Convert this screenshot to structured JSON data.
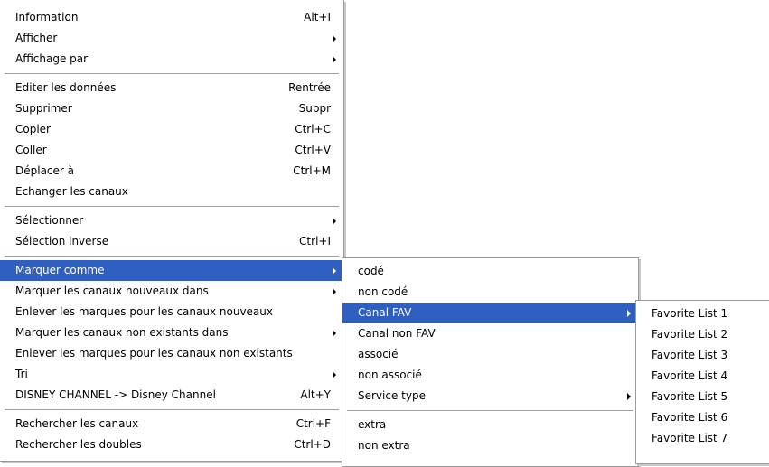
{
  "main_menu": {
    "info": {
      "label": "Information",
      "shortcut": "Alt+I"
    },
    "afficher": "Afficher",
    "affichage_par": "Affichage par",
    "editer": {
      "label": "Editer les données",
      "shortcut": "Rentrée"
    },
    "supprimer": {
      "label": "Supprimer",
      "shortcut": "Suppr"
    },
    "copier": {
      "label": "Copier",
      "shortcut": "Ctrl+C"
    },
    "coller": {
      "label": "Coller",
      "shortcut": "Ctrl+V"
    },
    "deplacer": {
      "label": "Déplacer à",
      "shortcut": "Ctrl+M"
    },
    "echanger": "Echanger les canaux",
    "selectionner": "Sélectionner",
    "selection_inverse": {
      "label": "Sélection inverse",
      "shortcut": "Ctrl+I"
    },
    "marquer_comme": "Marquer comme",
    "marquer_nouveaux": "Marquer les canaux nouveaux dans",
    "enlever_nouveaux": "Enlever les marques pour les canaux nouveaux",
    "marquer_non_existants": "Marquer les canaux non existants dans",
    "enlever_non_existants": "Enlever les marques pour les canaux non existants",
    "tri": "Tri",
    "rename": {
      "label": "DISNEY CHANNEL -> Disney Channel",
      "shortcut": "Alt+Y"
    },
    "rechercher_canaux": {
      "label": "Rechercher les canaux",
      "shortcut": "Ctrl+F"
    },
    "rechercher_doubles": {
      "label": "Rechercher les doubles",
      "shortcut": "Ctrl+D"
    }
  },
  "submenu_marquer": {
    "code": "codé",
    "non_code": "non codé",
    "canal_fav": "Canal FAV",
    "canal_non_fav": "Canal non FAV",
    "associe": "associé",
    "non_associe": "non associé",
    "service_type": "Service type",
    "extra": "extra",
    "non_extra": "non extra"
  },
  "submenu_fav": [
    "Favorite List 1",
    "Favorite List 2",
    "Favorite List 3",
    "Favorite List 4",
    "Favorite List 5",
    "Favorite List 6",
    "Favorite List 7"
  ],
  "colors": {
    "highlight": "#2f5fc1",
    "separator": "#a0a0a0",
    "border": "#9a9a9a"
  }
}
